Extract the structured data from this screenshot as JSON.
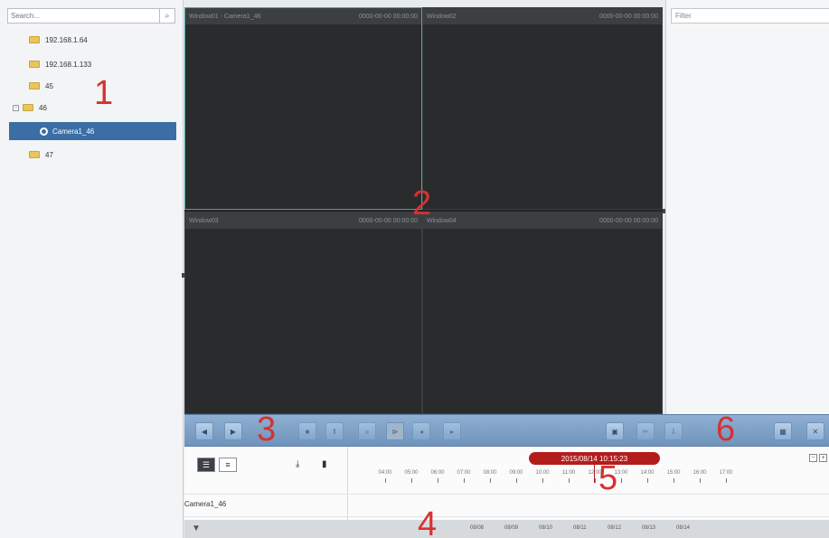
{
  "left_panel": {
    "search_placeholder": "Search...",
    "tree": [
      {
        "label": "192.168.1.64"
      },
      {
        "label": "192.168.1.133"
      },
      {
        "label": "45"
      },
      {
        "label": "46",
        "expanded": true
      },
      {
        "label": "47"
      }
    ],
    "selected_camera": "Camera1_46",
    "marker": "1"
  },
  "video": {
    "windows": [
      {
        "title": "Window01 - Camera1_46",
        "time": "0000-00-00 00:00:00"
      },
      {
        "title": "Window02",
        "time": "0000-00-00 00:00:00"
      },
      {
        "title": "Window03",
        "time": "0000-00-00 00:00:00"
      },
      {
        "title": "Window04",
        "time": "0000-00-00 00:00:00"
      }
    ],
    "marker": "2"
  },
  "right_panel": {
    "filter_placeholder": "Filter"
  },
  "toolbar": {
    "marker_playback": "3",
    "marker_tools": "6",
    "icons": [
      "rewind-icon",
      "play-icon",
      "stop-icon",
      "slow-icon",
      "fast-icon",
      "frame-back-icon",
      "frame-forward-icon",
      "single-frame-icon",
      "capture-icon",
      "clip-icon",
      "download-icon",
      "layout-icon",
      "close-icon"
    ]
  },
  "timeline": {
    "current_time": "2015/08/14 10:15:23",
    "camera_label": "Camera1_46",
    "hours": [
      "04:00",
      "05:00",
      "06:00",
      "07:00",
      "08:00",
      "09:00",
      "10:00",
      "11:00",
      "12:00",
      "13:00",
      "14:00",
      "15:00",
      "16:00",
      "17:00"
    ],
    "dates": [
      "08/08",
      "08/09",
      "08/10",
      "08/11",
      "08/12",
      "08/13",
      "08/14"
    ],
    "marker_timeline": "5",
    "marker_bottom": "4"
  }
}
